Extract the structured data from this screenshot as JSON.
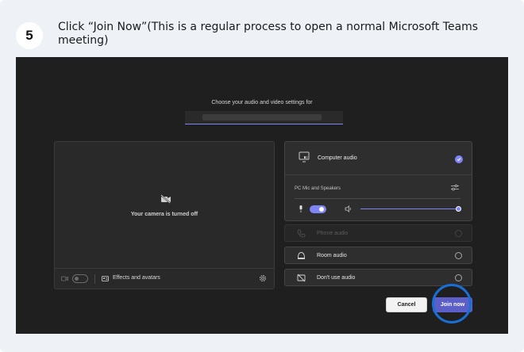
{
  "step": {
    "number": "5",
    "instruction": "Click “Join Now”(This is a regular process to open a normal Microsoft Teams meeting)"
  },
  "prejoin": {
    "choose_text": "Choose your audio and video settings for",
    "camera": {
      "off_text": "Your camera is turned off",
      "effects_label": "Effects and avatars",
      "camera_toggle": "off"
    },
    "audio": {
      "computer_audio_label": "Computer audio",
      "computer_audio_selected": true,
      "device_label": "PC Mic and Speakers",
      "mic_toggle": "on",
      "volume": 1.0,
      "options": [
        {
          "label": "Phone audio",
          "enabled": false,
          "icon": "phone-icon"
        },
        {
          "label": "Room audio",
          "enabled": true,
          "icon": "room-speaker-icon"
        },
        {
          "label": "Don't use audio",
          "enabled": true,
          "icon": "no-audio-icon"
        }
      ]
    },
    "buttons": {
      "cancel": "Cancel",
      "join": "Join now"
    }
  },
  "colors": {
    "accent": "#7f85f5",
    "join_button": "#5b5fc7",
    "highlight": "#1a6fd4",
    "background": "#201f1f"
  }
}
